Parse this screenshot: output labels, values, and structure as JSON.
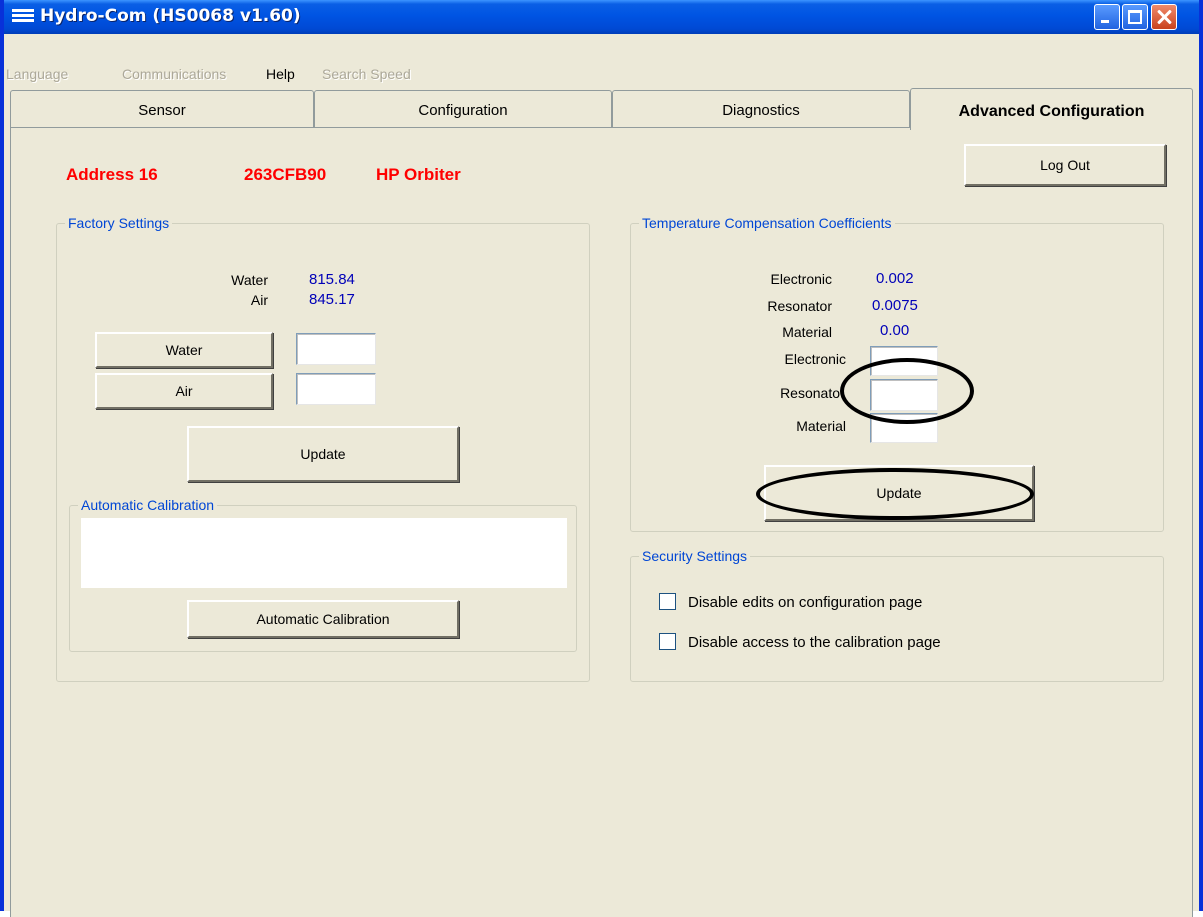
{
  "window": {
    "title": "Hydro-Com (HS0068 v1.60)"
  },
  "menu": {
    "items": [
      "Language",
      "Communications",
      "Help",
      "Search Speed"
    ]
  },
  "tabs": [
    "Sensor",
    "Configuration",
    "Diagnostics",
    "Advanced Configuration"
  ],
  "header": {
    "address": "Address 16",
    "serial": "263CFB90",
    "model": "HP Orbiter",
    "logout_label": "Log Out"
  },
  "factory": {
    "legend": "Factory Settings",
    "water_label": "Water",
    "water_value": "815.84",
    "air_label": "Air",
    "air_value": "845.17",
    "water_button": "Water",
    "air_button": "Air",
    "update_button": "Update",
    "auto_legend": "Automatic Calibration",
    "auto_button": "Automatic Calibration"
  },
  "temp": {
    "legend": "Temperature Compensation Coefficients",
    "electronic_label": "Electronic",
    "electronic_value": "0.002",
    "resonator_label": "Resonator",
    "resonator_value": "0.0075",
    "material_label": "Material",
    "material_value": "0.00",
    "electronic_input_label": "Electronic",
    "resonator_input_label": "Resonato",
    "material_input_label": "Material",
    "update_button": "Update"
  },
  "security": {
    "legend": "Security Settings",
    "disable_edits": "Disable edits on configuration page",
    "disable_access": "Disable access to the calibration page"
  },
  "colors": {
    "accent_red": "#FF0000",
    "value_blue": "#0000B8",
    "legend_blue": "#0046D5",
    "titlebar_blue": "#0054E3"
  }
}
